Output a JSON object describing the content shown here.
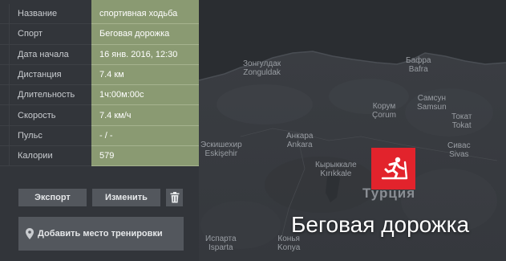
{
  "stats": [
    {
      "label": "Название",
      "value": "спортивная ходьба"
    },
    {
      "label": "Спорт",
      "value": "Беговая дорожка"
    },
    {
      "label": "Дата начала",
      "value": "16 янв. 2016, 12:30"
    },
    {
      "label": "Дистанция",
      "value": "7.4 км"
    },
    {
      "label": "Длительность",
      "value": "1ч:00м:00с"
    },
    {
      "label": "Скорость",
      "value": "7.4 км/ч"
    },
    {
      "label": "Пульс",
      "value": "- / -"
    },
    {
      "label": "Калории",
      "value": "579"
    }
  ],
  "actions": {
    "export_label": "Экспорт",
    "edit_label": "Изменить",
    "delete_icon": "trash-icon",
    "add_location_label": "Добавить место тренировки",
    "add_location_icon": "map-pin-icon"
  },
  "sport_badge": {
    "label": "Беговая дорожка",
    "icon": "treadmill-runner-icon",
    "color": "#e2232c"
  },
  "map": {
    "labels": [
      {
        "text": "Зонгулдак",
        "sub": "Zonguldak"
      },
      {
        "text": "Бафра",
        "sub": "Bafra"
      },
      {
        "text": "Самсун",
        "sub": "Samsun"
      },
      {
        "text": "Корум",
        "sub": "Çorum"
      },
      {
        "text": "Токат",
        "sub": "Tokat"
      },
      {
        "text": "Анкара",
        "sub": "Ankara"
      },
      {
        "text": "Эскишехир",
        "sub": "Eskişehir"
      },
      {
        "text": "Кырыккале",
        "sub": "Kırıkkale"
      },
      {
        "text": "Сивас",
        "sub": "Sivas"
      },
      {
        "text": "Турция",
        "sub": ""
      },
      {
        "text": "Испарта",
        "sub": "Isparta"
      },
      {
        "text": "Конья",
        "sub": "Konya"
      }
    ]
  },
  "colors": {
    "panel": "#32353a",
    "value_cell": "#8a9a72",
    "button": "#53575d"
  }
}
